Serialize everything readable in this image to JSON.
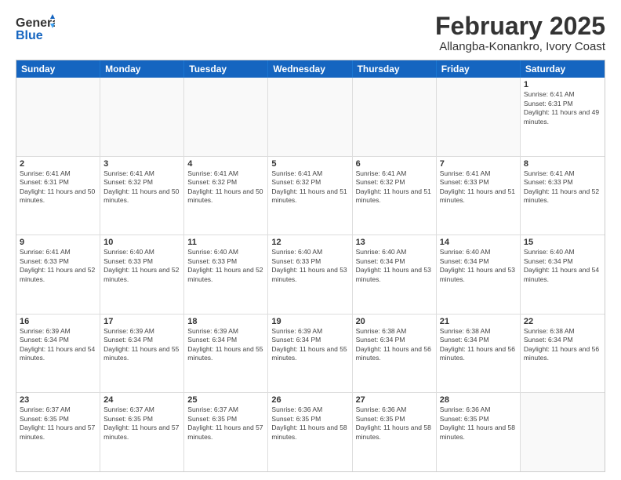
{
  "header": {
    "logo_line1": "General",
    "logo_line2": "Blue",
    "month": "February 2025",
    "location": "Allangba-Konankro, Ivory Coast"
  },
  "weekdays": [
    "Sunday",
    "Monday",
    "Tuesday",
    "Wednesday",
    "Thursday",
    "Friday",
    "Saturday"
  ],
  "weeks": [
    [
      {
        "day": "",
        "info": ""
      },
      {
        "day": "",
        "info": ""
      },
      {
        "day": "",
        "info": ""
      },
      {
        "day": "",
        "info": ""
      },
      {
        "day": "",
        "info": ""
      },
      {
        "day": "",
        "info": ""
      },
      {
        "day": "1",
        "info": "Sunrise: 6:41 AM\nSunset: 6:31 PM\nDaylight: 11 hours and 49 minutes."
      }
    ],
    [
      {
        "day": "2",
        "info": "Sunrise: 6:41 AM\nSunset: 6:31 PM\nDaylight: 11 hours and 50 minutes."
      },
      {
        "day": "3",
        "info": "Sunrise: 6:41 AM\nSunset: 6:32 PM\nDaylight: 11 hours and 50 minutes."
      },
      {
        "day": "4",
        "info": "Sunrise: 6:41 AM\nSunset: 6:32 PM\nDaylight: 11 hours and 50 minutes."
      },
      {
        "day": "5",
        "info": "Sunrise: 6:41 AM\nSunset: 6:32 PM\nDaylight: 11 hours and 51 minutes."
      },
      {
        "day": "6",
        "info": "Sunrise: 6:41 AM\nSunset: 6:32 PM\nDaylight: 11 hours and 51 minutes."
      },
      {
        "day": "7",
        "info": "Sunrise: 6:41 AM\nSunset: 6:33 PM\nDaylight: 11 hours and 51 minutes."
      },
      {
        "day": "8",
        "info": "Sunrise: 6:41 AM\nSunset: 6:33 PM\nDaylight: 11 hours and 52 minutes."
      }
    ],
    [
      {
        "day": "9",
        "info": "Sunrise: 6:41 AM\nSunset: 6:33 PM\nDaylight: 11 hours and 52 minutes."
      },
      {
        "day": "10",
        "info": "Sunrise: 6:40 AM\nSunset: 6:33 PM\nDaylight: 11 hours and 52 minutes."
      },
      {
        "day": "11",
        "info": "Sunrise: 6:40 AM\nSunset: 6:33 PM\nDaylight: 11 hours and 52 minutes."
      },
      {
        "day": "12",
        "info": "Sunrise: 6:40 AM\nSunset: 6:33 PM\nDaylight: 11 hours and 53 minutes."
      },
      {
        "day": "13",
        "info": "Sunrise: 6:40 AM\nSunset: 6:34 PM\nDaylight: 11 hours and 53 minutes."
      },
      {
        "day": "14",
        "info": "Sunrise: 6:40 AM\nSunset: 6:34 PM\nDaylight: 11 hours and 53 minutes."
      },
      {
        "day": "15",
        "info": "Sunrise: 6:40 AM\nSunset: 6:34 PM\nDaylight: 11 hours and 54 minutes."
      }
    ],
    [
      {
        "day": "16",
        "info": "Sunrise: 6:39 AM\nSunset: 6:34 PM\nDaylight: 11 hours and 54 minutes."
      },
      {
        "day": "17",
        "info": "Sunrise: 6:39 AM\nSunset: 6:34 PM\nDaylight: 11 hours and 55 minutes."
      },
      {
        "day": "18",
        "info": "Sunrise: 6:39 AM\nSunset: 6:34 PM\nDaylight: 11 hours and 55 minutes."
      },
      {
        "day": "19",
        "info": "Sunrise: 6:39 AM\nSunset: 6:34 PM\nDaylight: 11 hours and 55 minutes."
      },
      {
        "day": "20",
        "info": "Sunrise: 6:38 AM\nSunset: 6:34 PM\nDaylight: 11 hours and 56 minutes."
      },
      {
        "day": "21",
        "info": "Sunrise: 6:38 AM\nSunset: 6:34 PM\nDaylight: 11 hours and 56 minutes."
      },
      {
        "day": "22",
        "info": "Sunrise: 6:38 AM\nSunset: 6:34 PM\nDaylight: 11 hours and 56 minutes."
      }
    ],
    [
      {
        "day": "23",
        "info": "Sunrise: 6:37 AM\nSunset: 6:35 PM\nDaylight: 11 hours and 57 minutes."
      },
      {
        "day": "24",
        "info": "Sunrise: 6:37 AM\nSunset: 6:35 PM\nDaylight: 11 hours and 57 minutes."
      },
      {
        "day": "25",
        "info": "Sunrise: 6:37 AM\nSunset: 6:35 PM\nDaylight: 11 hours and 57 minutes."
      },
      {
        "day": "26",
        "info": "Sunrise: 6:36 AM\nSunset: 6:35 PM\nDaylight: 11 hours and 58 minutes."
      },
      {
        "day": "27",
        "info": "Sunrise: 6:36 AM\nSunset: 6:35 PM\nDaylight: 11 hours and 58 minutes."
      },
      {
        "day": "28",
        "info": "Sunrise: 6:36 AM\nSunset: 6:35 PM\nDaylight: 11 hours and 58 minutes."
      },
      {
        "day": "",
        "info": ""
      }
    ]
  ]
}
